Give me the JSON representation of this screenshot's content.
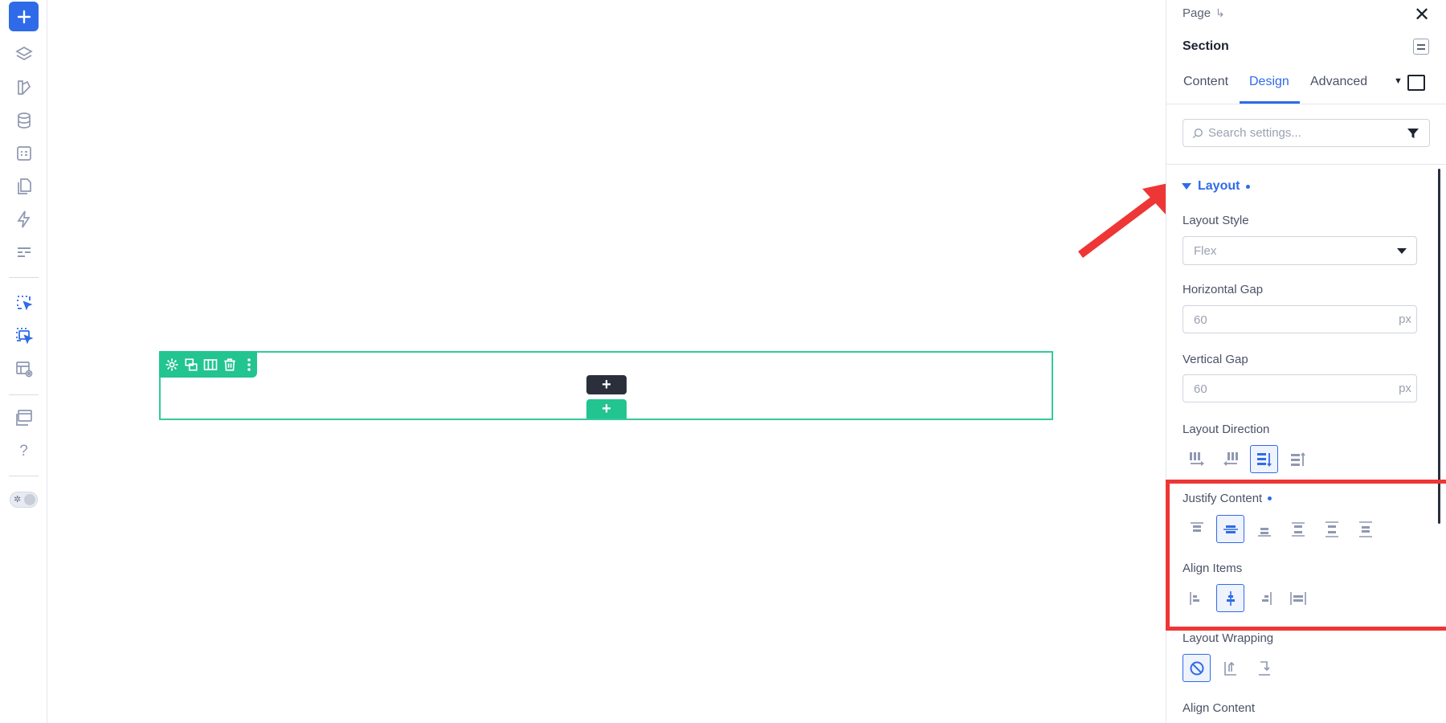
{
  "left_rail": {
    "items": [
      {
        "name": "add-icon"
      },
      {
        "name": "layers-icon"
      },
      {
        "name": "design-icon"
      },
      {
        "name": "database-icon"
      },
      {
        "name": "form-icon"
      },
      {
        "name": "pages-icon"
      },
      {
        "name": "lightning-icon"
      },
      {
        "name": "template-icon"
      },
      {
        "name": "select-element-icon"
      },
      {
        "name": "multi-select-icon"
      },
      {
        "name": "preview-icon"
      },
      {
        "name": "window-icon"
      },
      {
        "name": "help-icon"
      }
    ],
    "help_label": "?"
  },
  "canvas": {
    "add_dark_label": "+",
    "add_green_label": "+"
  },
  "panel": {
    "breadcrumb": "Page",
    "breadcrumb_arrow": "↳",
    "close_label": "✕",
    "title": "Section",
    "tabs": [
      {
        "label": "Content",
        "active": false
      },
      {
        "label": "Design",
        "active": true
      },
      {
        "label": "Advanced",
        "active": false
      }
    ],
    "search_placeholder": "Search settings...",
    "layout_section": {
      "title": "Layout",
      "layout_style_label": "Layout Style",
      "layout_style_value": "Flex",
      "horizontal_gap_label": "Horizontal Gap",
      "horizontal_gap_value": "60",
      "horizontal_gap_unit": "px",
      "vertical_gap_label": "Vertical Gap",
      "vertical_gap_value": "60",
      "vertical_gap_unit": "px",
      "layout_direction_label": "Layout Direction",
      "justify_content_label": "Justify Content",
      "align_items_label": "Align Items",
      "layout_wrapping_label": "Layout Wrapping",
      "align_content_label": "Align Content"
    }
  },
  "colors": {
    "accent": "#2f6be8",
    "canvas_section": "#22c48f",
    "highlight": "#ee3636",
    "muted_icon": "#8f98b0"
  }
}
